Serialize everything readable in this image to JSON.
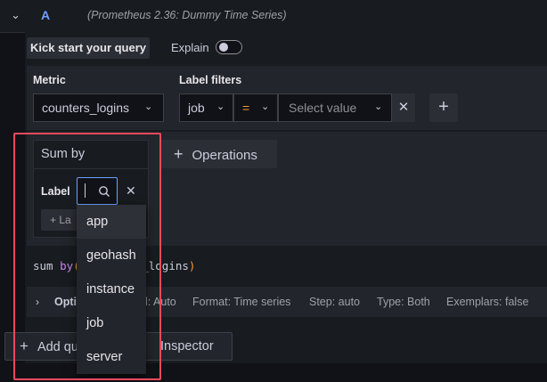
{
  "query": {
    "ref_id": "A",
    "datasource": "(Prometheus 2.36: Dummy Time Series)"
  },
  "builder": {
    "kickstart_label": "Kick start your query",
    "explain_label": "Explain",
    "explain_on": false
  },
  "metric": {
    "label": "Metric",
    "value": "counters_logins"
  },
  "label_filters": {
    "label": "Label filters",
    "key": "job",
    "operator": "=",
    "value_placeholder": "Select value"
  },
  "operations": {
    "add_label": "Operations",
    "sum_by": {
      "title": "Sum by",
      "label_text": "Label",
      "add_label_button": "La"
    }
  },
  "dropdown": {
    "options": [
      "app",
      "geohash",
      "instance",
      "job",
      "server"
    ],
    "highlighted_index": 0
  },
  "preview": {
    "sum": "sum",
    "by": "by",
    "open_paren": "(",
    "metric_visible": "s_logins",
    "close_paren": ")"
  },
  "options": {
    "title": "Opti",
    "legend": "l: Auto",
    "format": "Format: Time series",
    "step": "Step: auto",
    "type": "Type: Both",
    "exemplars": "Exemplars: false"
  },
  "footer": {
    "add_query": "Add qu",
    "inspector": "Inspector"
  },
  "colors": {
    "highlight": "#f2495c",
    "operator": "#ff9830",
    "keyword": "#c586e8",
    "query_letter": "#6e9fff"
  }
}
